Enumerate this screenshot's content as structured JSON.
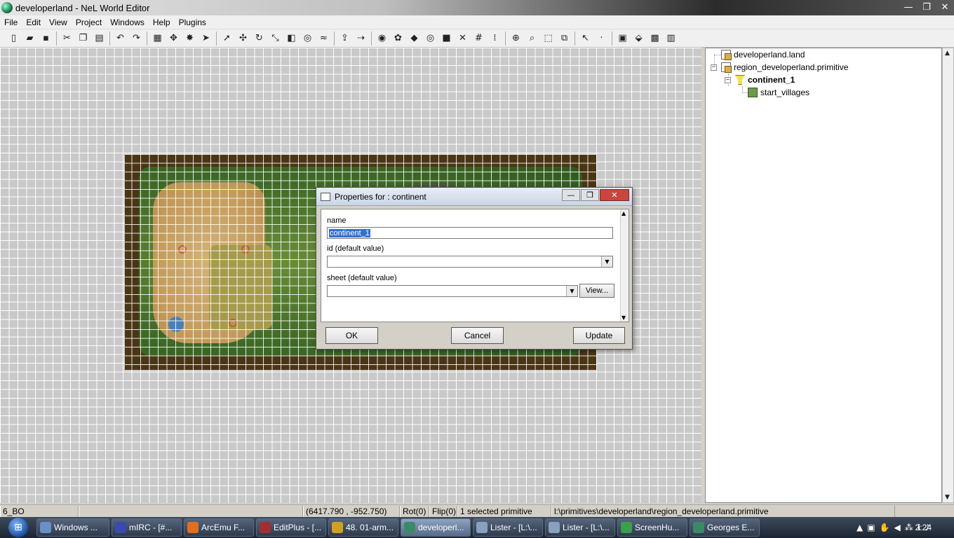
{
  "window": {
    "title": "developerland - NeL World Editor",
    "min": "—",
    "max": "❐",
    "close": "✕"
  },
  "menu": [
    "File",
    "Edit",
    "View",
    "Project",
    "Windows",
    "Help",
    "Plugins"
  ],
  "toolbar_icons": [
    "new-icon",
    "open-icon",
    "save-icon",
    "sep",
    "cut-icon",
    "copy-icon",
    "paste-icon",
    "sep",
    "undo-icon",
    "redo-icon",
    "sep",
    "grid-icon",
    "snap-icon",
    "landscape-icon",
    "line-icon",
    "sep",
    "select-icon",
    "move-icon",
    "rotate-icon",
    "scale-icon",
    "turn-icon",
    "radius-icon",
    "path-icon",
    "sep",
    "load-icon",
    "export-icon",
    "sep",
    "globe-icon",
    "flower-icon",
    "palette-icon",
    "target-icon",
    "layer-icon",
    "cross-icon",
    "grid-show-icon",
    "dots-icon",
    "sep",
    "zoom-world-icon",
    "zoom-icon",
    "fit-icon",
    "select-region-icon",
    "sep",
    "cursor-tool-icon",
    "point-icon",
    "sep",
    "properties-icon",
    "eraser-icon",
    "bitmap-icon",
    "doc-icon"
  ],
  "tree": {
    "nodes": [
      {
        "label": "developerland.land",
        "icon": "land-file-icon",
        "level": 0,
        "bold": false
      },
      {
        "label": "region_developerland.primitive",
        "icon": "primitive-file-icon",
        "level": 0,
        "bold": false
      },
      {
        "label": "continent_1",
        "icon": "continent-icon",
        "level": 1,
        "bold": true
      },
      {
        "label": "start_villages",
        "icon": "villages-icon",
        "level": 2,
        "bold": false
      }
    ]
  },
  "dialog": {
    "title": "Properties for : continent",
    "name_label": "name",
    "name_value": "continent_1",
    "id_label": "id (default value)",
    "id_value": "",
    "sheet_label": "sheet (default value)",
    "sheet_value": "",
    "view_button": "View...",
    "ok": "OK",
    "cancel": "Cancel",
    "update": "Update"
  },
  "status": {
    "region": "6_BO",
    "empty": "",
    "coords": "(6417.790 , -952.750)",
    "rot": "Rot(0)",
    "flip": "Flip(0)",
    "selection": "1 selected primitive",
    "path": "l:\\primitives\\developerland\\region_developerland.primitive"
  },
  "taskbar": {
    "tasks": [
      {
        "label": "Windows ...",
        "color": "#6a8fc8"
      },
      {
        "label": "mIRC - [#...",
        "color": "#3a4ab0"
      },
      {
        "label": "ArcEmu F...",
        "color": "#e07020"
      },
      {
        "label": "EditPlus - [...",
        "color": "#a03030"
      },
      {
        "label": "48. 01-arm...",
        "color": "#d0a020"
      },
      {
        "label": "developerl...",
        "color": "#3a8a6a",
        "active": true
      },
      {
        "label": "Lister - [L:\\...",
        "color": "#8aa0c0"
      },
      {
        "label": "Lister - [L:\\...",
        "color": "#8aa0c0"
      },
      {
        "label": "ScreenHu...",
        "color": "#3aa04a"
      },
      {
        "label": "Georges E...",
        "color": "#3a8a6a"
      }
    ],
    "clock": "2:24"
  }
}
